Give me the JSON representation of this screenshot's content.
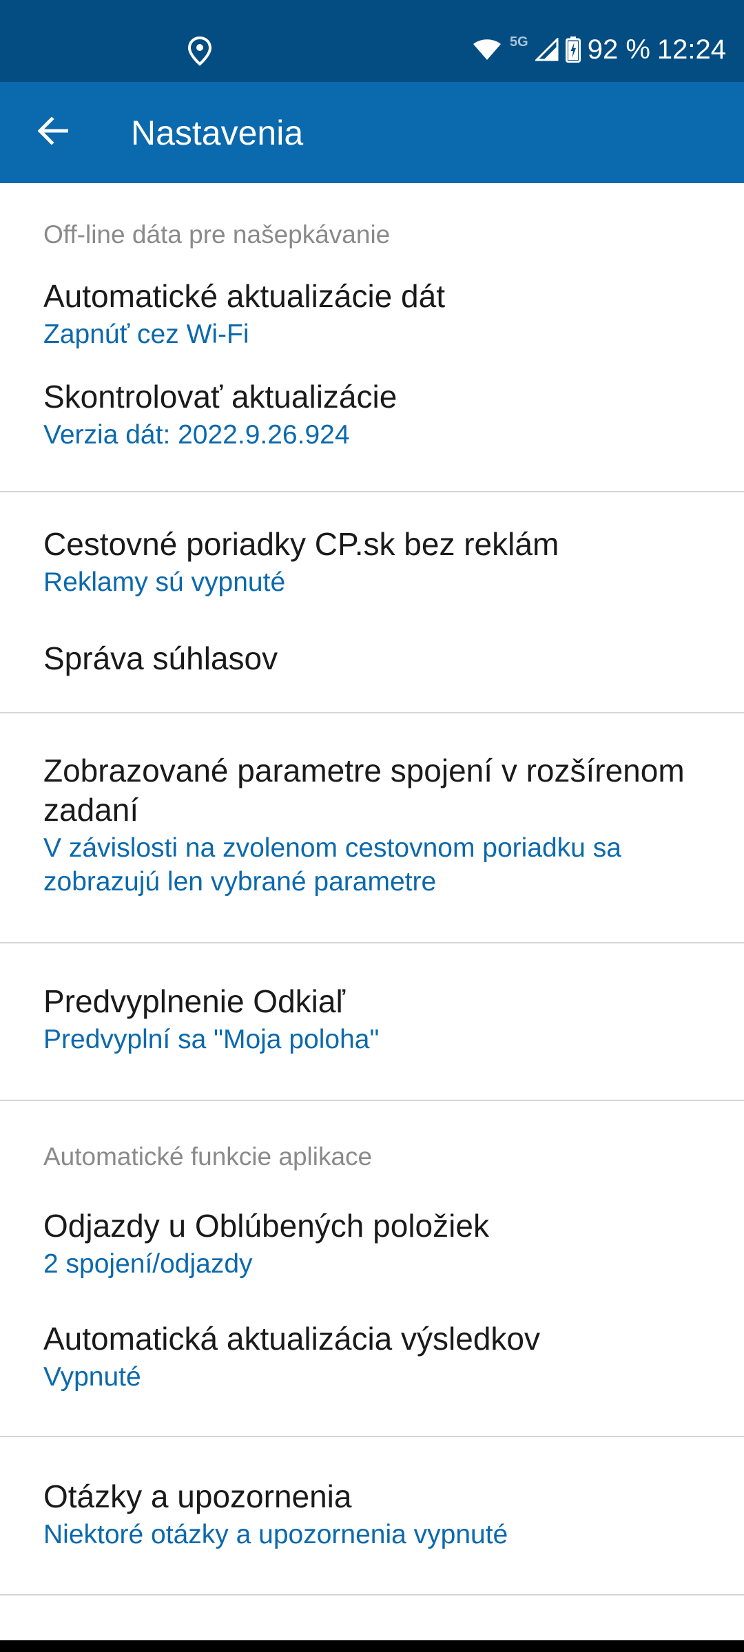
{
  "status_bar": {
    "network": "5G",
    "battery": "92 %",
    "time": "12:24"
  },
  "app_bar": {
    "title": "Nastavenia"
  },
  "settings": {
    "offline_header": "Off-line dáta pre našepkávanie",
    "auto_update": {
      "title": "Automatické aktualizácie dát",
      "summary": "Zapnúť cez Wi-Fi"
    },
    "check_updates": {
      "title": "Skontrolovať aktualizácie",
      "summary": "Verzia dát: 2022.9.26.924"
    },
    "no_ads": {
      "title": "Cestovné poriadky CP.sk bez reklám",
      "summary": "Reklamy sú vypnuté"
    },
    "consent": {
      "title": "Správa súhlasov"
    },
    "params": {
      "title": "Zobrazované parametre spojení v rozšírenom zadaní",
      "summary": "V závislosti na zvolenom cestovnom poriadku sa zobrazujú len vybrané parametre"
    },
    "prefill": {
      "title": "Predvyplnenie Odkiaľ",
      "summary": "Predvyplní sa \"Moja poloha\""
    },
    "auto_header": "Automatické funkcie aplikace",
    "departures": {
      "title": "Odjazdy u Oblúbených položiek",
      "summary": "2 spojení/odjazdy"
    },
    "auto_results": {
      "title": "Automatická aktualizácia výsledkov",
      "summary": "Vypnuté"
    },
    "questions": {
      "title": "Otázky a upozornenia",
      "summary": "Niektoré otázky a upozornenia vypnuté"
    }
  }
}
